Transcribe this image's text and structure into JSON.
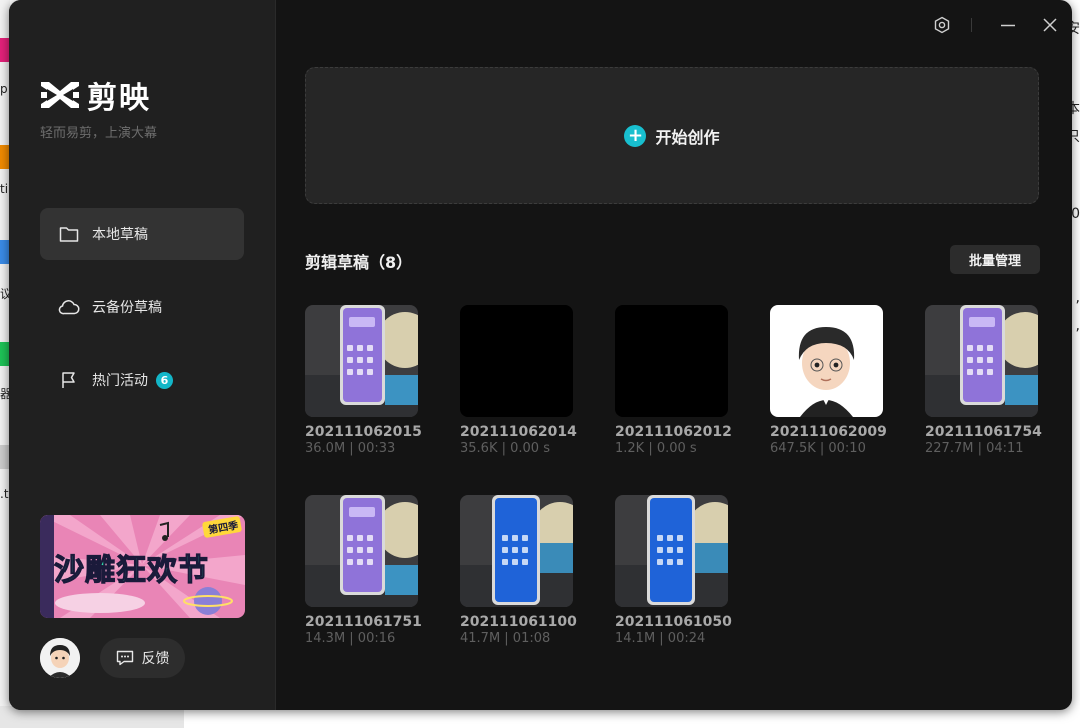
{
  "desktop": {
    "left_texts": [
      "p",
      "ti",
      "议",
      "器",
      ".t"
    ],
    "right_texts": [
      "安",
      "本",
      "只",
      "0",
      ",",
      ","
    ]
  },
  "app": {
    "logo_text": "剪映",
    "slogan": "轻而易剪，上演大幕",
    "nav": [
      {
        "label": "本地草稿",
        "icon": "folder-icon",
        "active": true
      },
      {
        "label": "云备份草稿",
        "icon": "cloud-icon",
        "active": false
      },
      {
        "label": "热门活动",
        "icon": "flag-icon",
        "active": false,
        "badge": "6"
      }
    ],
    "banner": {
      "title": "沙雕狂欢节",
      "tag": "第四季"
    },
    "feedback_label": "反馈",
    "create_label": "开始创作",
    "section_title": "剪辑草稿（8）",
    "batch_label": "批量管理",
    "drafts": [
      {
        "name": "202111062015",
        "meta": "36.0M | 00:33",
        "thumb": "phone-purple"
      },
      {
        "name": "202111062014",
        "meta": "35.6K | 0.00 s",
        "thumb": "black"
      },
      {
        "name": "202111062012",
        "meta": "1.2K | 0.00 s",
        "thumb": "black"
      },
      {
        "name": "202111062009",
        "meta": "647.5K | 00:10",
        "thumb": "avatar"
      },
      {
        "name": "202111061754",
        "meta": "227.7M | 04:11",
        "thumb": "phone-purple"
      },
      {
        "name": "202111061751",
        "meta": "14.3M | 00:16",
        "thumb": "phone-purple"
      },
      {
        "name": "202111061100",
        "meta": "41.7M | 01:08",
        "thumb": "phone-blue"
      },
      {
        "name": "202111061050",
        "meta": "14.1M | 00:24",
        "thumb": "phone-blue"
      }
    ],
    "colors": {
      "accent": "#18bfcf",
      "sidebar": "#202020",
      "main": "#141414"
    }
  }
}
